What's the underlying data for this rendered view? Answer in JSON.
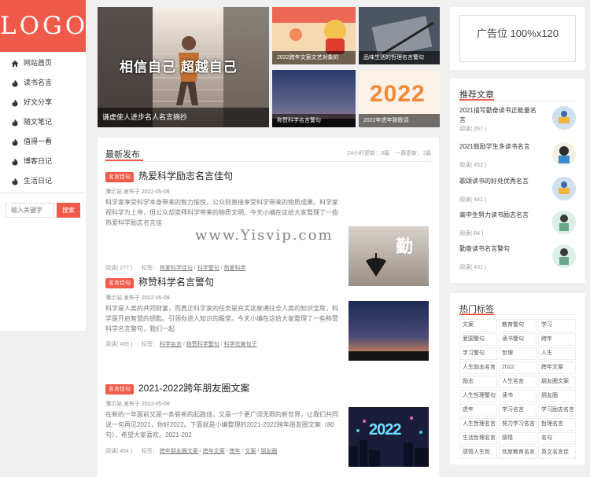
{
  "logo": "LOGO",
  "nav": [
    "网站首页",
    "读书名言",
    "好文分享",
    "随文笔记",
    "值得一看",
    "博客日记",
    "生活日记"
  ],
  "search": {
    "placeholder": "输入关键字",
    "button": "搜索"
  },
  "banner": {
    "big_caption": "谦虚使人进步名人名言摘抄",
    "big_overlay": "相信自己 超越自己",
    "items": [
      {
        "caption": "2022跨年文案文艺对象的"
      },
      {
        "caption": "品味生活的哲理名言警句"
      },
      {
        "caption": "称赞科学名言警句"
      },
      {
        "caption": "2022年虎年致歌词"
      }
    ],
    "year_text": "2022"
  },
  "feed": {
    "title": "最新发布",
    "stats": "24小时更新：0篇　一周更新：1篇",
    "articles": [
      {
        "badge": "名言佳句",
        "title": "热爱科学励志名言佳句",
        "meta": "薄示站 发布于 2022-05-09",
        "excerpt": "科学家享受科学本身带来的智力愉悦，公众则直接享受科学带来的物质成果。科学家视科学为上帝，但公众却崇拜科学带来的物质文明。今天小编在这给大家整理了一些热爱科学励志名言佳",
        "views": "阅读( 277 )",
        "tags_label": "标签：",
        "tags": [
          "热爱科学佳句",
          "科学警句",
          "热爱科学"
        ]
      },
      {
        "badge": "名言佳句",
        "title": "称赞科学名言警句",
        "meta": "薄示站 发布于 2022-05-09",
        "excerpt": "科学是人类的共同财富，而真正科学家的任务是充实这座通往全人类的知识宝库，科学是开启智慧的钥匙。引领你进入知识的殿堂。今天小编在这给大家整理了一些称赞科学名言警句，我们一起",
        "views": "阅读( 489 )",
        "tags_label": "标签：",
        "tags": [
          "科学名言",
          "称赞科学警句",
          "科学优美句子"
        ]
      },
      {
        "badge": "名言佳句",
        "title": "2021-2022跨年朋友圈文案",
        "meta": "薄示站 发布于 2022-05-09",
        "excerpt": "在新的一年面前又是一条崭新的起跑线，又是一个更广阔无限的新世界，让我们共同说一句再见2021，你好2022。下面就是小编整理的2021-2022跨年朋友圈文案（80句），希望大家喜欢。2021-202",
        "views": "阅读( 454 )",
        "tags_label": "标签：",
        "tags": [
          "跨年朋友圈文案",
          "跨年文案",
          "跨年",
          "文案",
          "朋友圈"
        ]
      }
    ],
    "thumb_text": "勤"
  },
  "ad": {
    "text": "广告位 100%x120"
  },
  "recommend": {
    "title": "推荐文章",
    "items": [
      {
        "title": "2021描写勤奋读书正能量名言",
        "views": "阅读( 267 )"
      },
      {
        "title": "2021鼓励学生多读书名言",
        "views": "阅读( 452 )"
      },
      {
        "title": "歌颂读书的好处优秀名言",
        "views": "阅读( 441 )"
      },
      {
        "title": "高中生努力读书励志名言",
        "views": "阅读( 84 )"
      },
      {
        "title": "勤奋读书名言警句",
        "views": "阅读( 431 )"
      }
    ]
  },
  "tags": {
    "title": "热门标签",
    "list": [
      "文案",
      "教育警句",
      "学习",
      "爱国警句",
      "读书警句",
      "跨年",
      "学习警句",
      "哲理",
      "人生",
      "人生励志名言",
      "2022",
      "跨年文案",
      "励志",
      "人生名言",
      "朋友圈文案",
      "人生哲理警句",
      "读书",
      "朋友圈",
      "虎年",
      "学习名言",
      "学习励志名言",
      "人生哲理名言",
      "努力学习名言",
      "哲理名言",
      "生活哲理名言",
      "感悟",
      "名句",
      "感悟人生哲",
      "欢度教育名言",
      "英文名言佳"
    ]
  },
  "watermark": "www.Yisvip.com",
  "colors": {
    "accent": "#f05a4a"
  }
}
